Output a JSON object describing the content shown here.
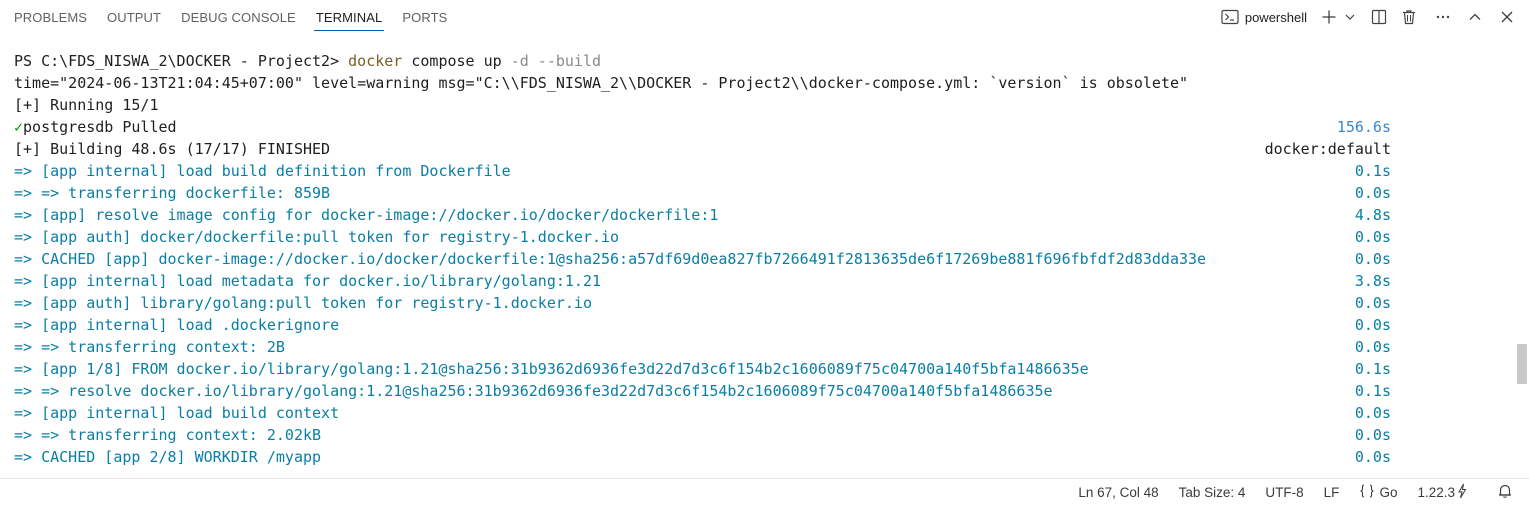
{
  "panel": {
    "tabs": [
      {
        "label": "PROBLEMS",
        "active": false
      },
      {
        "label": "OUTPUT",
        "active": false
      },
      {
        "label": "DEBUG CONSOLE",
        "active": false
      },
      {
        "label": "TERMINAL",
        "active": true
      },
      {
        "label": "PORTS",
        "active": false
      }
    ],
    "shell_name": "powershell"
  },
  "terminal": {
    "prompt": "PS C:\\FDS_NISWA_2\\DOCKER - Project2>",
    "command": "docker",
    "command_args": "compose up",
    "command_flags": "-d --build",
    "warning_line": "time=\"2024-06-13T21:04:45+07:00\" level=warning msg=\"C:\\\\FDS_NISWA_2\\\\DOCKER - Project2\\\\docker-compose.yml: `version` is obsolete\"",
    "running_line": "[+] Running 15/1",
    "pulled": {
      "check": "✓",
      "text": "postgresdb Pulled",
      "time": "156.6s"
    },
    "building": {
      "text": "[+] Building 48.6s (17/17) FINISHED",
      "right": "docker:default"
    },
    "steps": [
      {
        "text": "=> [app internal] load build definition from Dockerfile",
        "time": "0.1s"
      },
      {
        "text": "=> => transferring dockerfile: 859B",
        "time": "0.0s"
      },
      {
        "text": "=> [app] resolve image config for docker-image://docker.io/docker/dockerfile:1",
        "time": "4.8s"
      },
      {
        "text": "=> [app auth] docker/dockerfile:pull token for registry-1.docker.io",
        "time": "0.0s"
      },
      {
        "text": "=> CACHED [app] docker-image://docker.io/docker/dockerfile:1@sha256:a57df69d0ea827fb7266491f2813635de6f17269be881f696fbfdf2d83dda33e",
        "time": "0.0s"
      },
      {
        "text": "=> [app internal] load metadata for docker.io/library/golang:1.21",
        "time": "3.8s"
      },
      {
        "text": "=> [app auth] library/golang:pull token for registry-1.docker.io",
        "time": "0.0s"
      },
      {
        "text": "=> [app internal] load .dockerignore",
        "time": "0.0s"
      },
      {
        "text": "=> => transferring context: 2B",
        "time": "0.0s"
      },
      {
        "text": "=> [app 1/8] FROM docker.io/library/golang:1.21@sha256:31b9362d6936fe3d22d7d3c6f154b2c1606089f75c04700a140f5bfa1486635e",
        "time": "0.1s"
      },
      {
        "text": "=> => resolve docker.io/library/golang:1.21@sha256:31b9362d6936fe3d22d7d3c6f154b2c1606089f75c04700a140f5bfa1486635e",
        "time": "0.1s"
      },
      {
        "text": "=> [app internal] load build context",
        "time": "0.0s"
      },
      {
        "text": "=> => transferring context: 2.02kB",
        "time": "0.0s"
      },
      {
        "text": "=> CACHED [app 2/8] WORKDIR /myapp",
        "time": "0.0s"
      }
    ]
  },
  "statusbar": {
    "position": "Ln 67, Col 48",
    "tab_size": "Tab Size: 4",
    "encoding": "UTF-8",
    "eol": "LF",
    "language": "Go",
    "version": "1.22.3"
  },
  "colors": {
    "accent": "#005fb8",
    "step_blue": "#0a7ea4",
    "pulled_time_blue": "#3a86d4",
    "check_green": "#00a000",
    "command_yellow": "#795e26"
  }
}
